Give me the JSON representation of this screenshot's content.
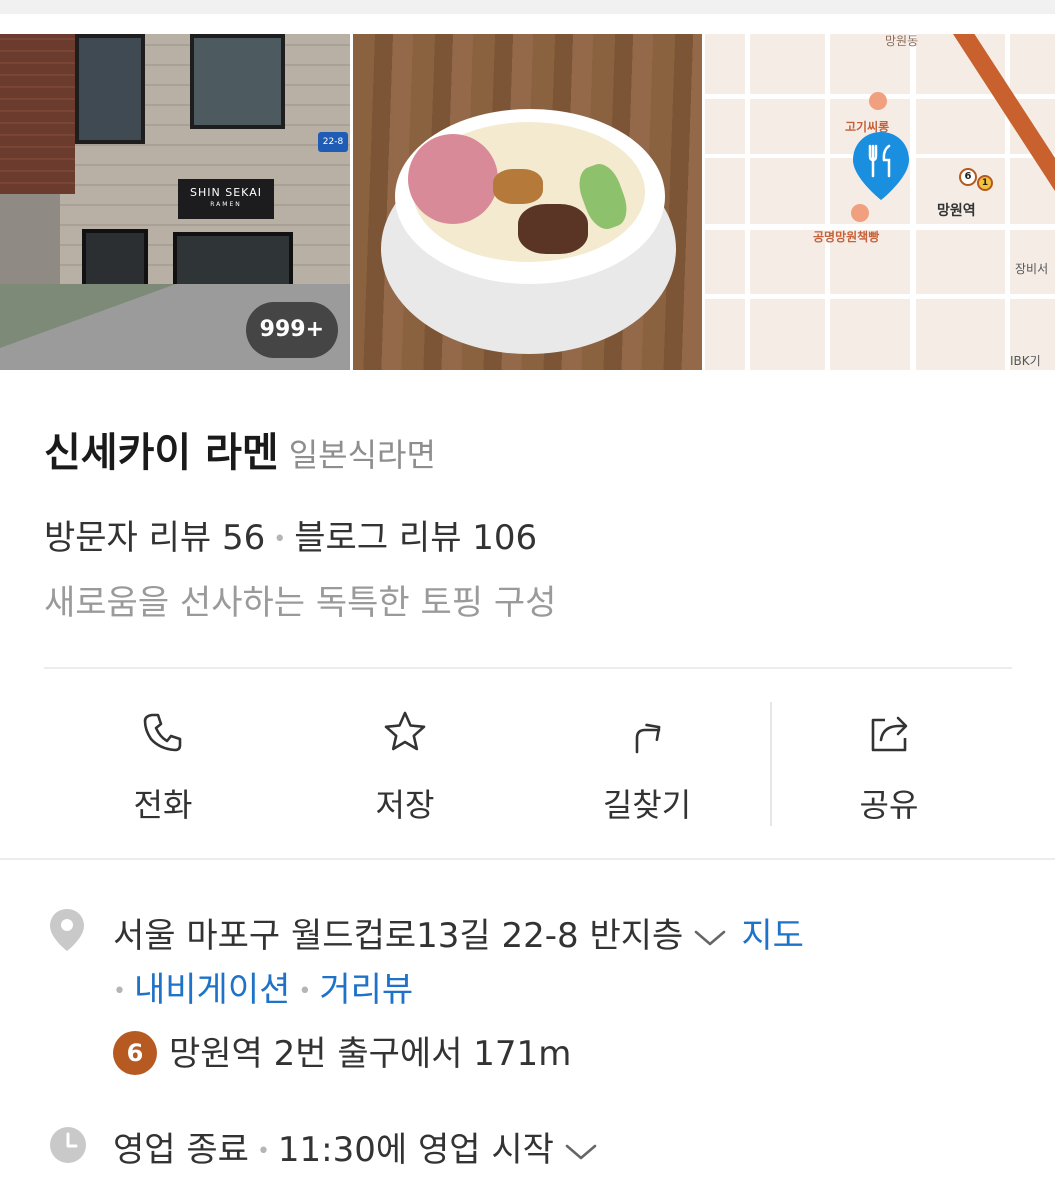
{
  "photos": {
    "count_badge": "999+",
    "storefront_sign": "SHIN SEKAI",
    "storefront_sign_sub": "RAMEN",
    "address_plate": "22-8",
    "map": {
      "station_label": "망원역",
      "poi_bakery": "공명망원책빵",
      "poi_partial_top": "고기씨롱",
      "poi_partial_right": "망원동",
      "poi_partial_bottom": "IBK기",
      "poi_partial_edge": "장비서",
      "subway_line_6": "6",
      "subway_line_1": "1"
    }
  },
  "place": {
    "name": "신세카이 라멘",
    "category": "일본식라면",
    "visitor_review_label": "방문자 리뷰 56",
    "blog_review_label": "블로그 리뷰 106",
    "description": "새로움을 선사하는 독특한 토핑 구성"
  },
  "actions": {
    "call": "전화",
    "save": "저장",
    "directions": "길찾기",
    "share": "공유"
  },
  "address": {
    "text": "서울 마포구 월드컵로13길 22-8 반지층",
    "map_link": "지도",
    "navigation_link": "내비게이션",
    "streetview_link": "거리뷰"
  },
  "subway": {
    "line": "6",
    "line_color": "#b65a22",
    "text": "망원역 2번 출구에서 171m"
  },
  "hours": {
    "status": "영업 종료",
    "next_open": "11:30에 영업 시작"
  },
  "colors": {
    "link": "#1e72c8",
    "pin": "#1a8fe0"
  }
}
